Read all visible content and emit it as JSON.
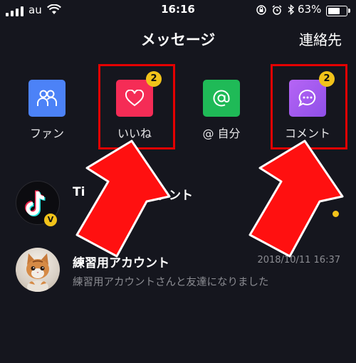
{
  "status_bar": {
    "carrier": "au",
    "time": "16:16",
    "battery": "63%"
  },
  "header": {
    "title": "メッセージ",
    "contacts_label": "連絡先"
  },
  "categories": [
    {
      "label": "ファン",
      "color": "#4c82f7",
      "icon": "users-icon"
    },
    {
      "label": "いいね",
      "color": "#f52c56",
      "icon": "heart-icon",
      "badge": "2"
    },
    {
      "label": "@ 自分",
      "color": "#1fba57",
      "icon": "at-icon"
    },
    {
      "label": "コメント",
      "color": "#a75ef2",
      "icon": "comment-icon",
      "badge": "2"
    }
  ],
  "messages": [
    {
      "name": "TikTok アシスタント",
      "name_visible": "Ti",
      "name_visible_tail": "シスタント",
      "preview": "く",
      "time": "昨日",
      "unread": true,
      "avatar": "tiktok-logo"
    },
    {
      "name": "練習用アカウント",
      "preview": "練習用アカウントさんと友達になりました",
      "time": "2018/10/11 16:37",
      "unread": false,
      "avatar": "kitten-photo"
    }
  ],
  "colors": {
    "background": "#15161e",
    "highlight": "#e40000",
    "badge": "#f2c31a"
  }
}
